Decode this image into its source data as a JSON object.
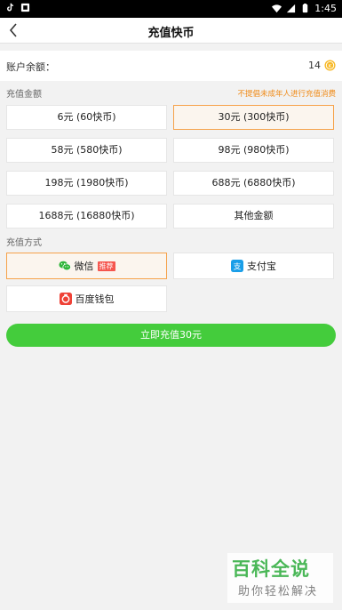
{
  "status_bar": {
    "time": "1:45",
    "icons": [
      "tiktok-icon",
      "notification-icon",
      "wifi-icon",
      "signal-icon",
      "battery-icon"
    ]
  },
  "nav": {
    "title": "充值快币",
    "back_icon": "chevron-left-icon"
  },
  "balance": {
    "label": "账户余额：",
    "value": "14",
    "icon": "coin-icon"
  },
  "amount_section": {
    "title": "充值金额",
    "notice": "不提倡未成年人进行充值消费",
    "options": [
      {
        "label": "6元 (60快币)",
        "selected": false
      },
      {
        "label": "30元 (300快币)",
        "selected": true
      },
      {
        "label": "58元 (580快币)",
        "selected": false
      },
      {
        "label": "98元 (980快币)",
        "selected": false
      },
      {
        "label": "198元 (1980快币)",
        "selected": false
      },
      {
        "label": "688元 (6880快币)",
        "selected": false
      },
      {
        "label": "1688元 (16880快币)",
        "selected": false
      },
      {
        "label": "其他金额",
        "selected": false
      }
    ]
  },
  "pay_section": {
    "title": "充值方式",
    "methods": [
      {
        "label": "微信",
        "badge": "推荐",
        "icon": "wechat-icon",
        "selected": true
      },
      {
        "label": "支付宝",
        "icon": "alipay-icon",
        "selected": false
      },
      {
        "label": "百度钱包",
        "icon": "baidu-wallet-icon",
        "selected": false
      }
    ]
  },
  "submit": {
    "label": "立即充值30元"
  },
  "watermark": {
    "main": "百科全说",
    "sub": "助你轻松解决"
  },
  "colors": {
    "accent_green": "#44cc3c",
    "selected_border": "#f6a24a",
    "notice_orange": "#f08a16",
    "badge_red": "#f5564e"
  }
}
